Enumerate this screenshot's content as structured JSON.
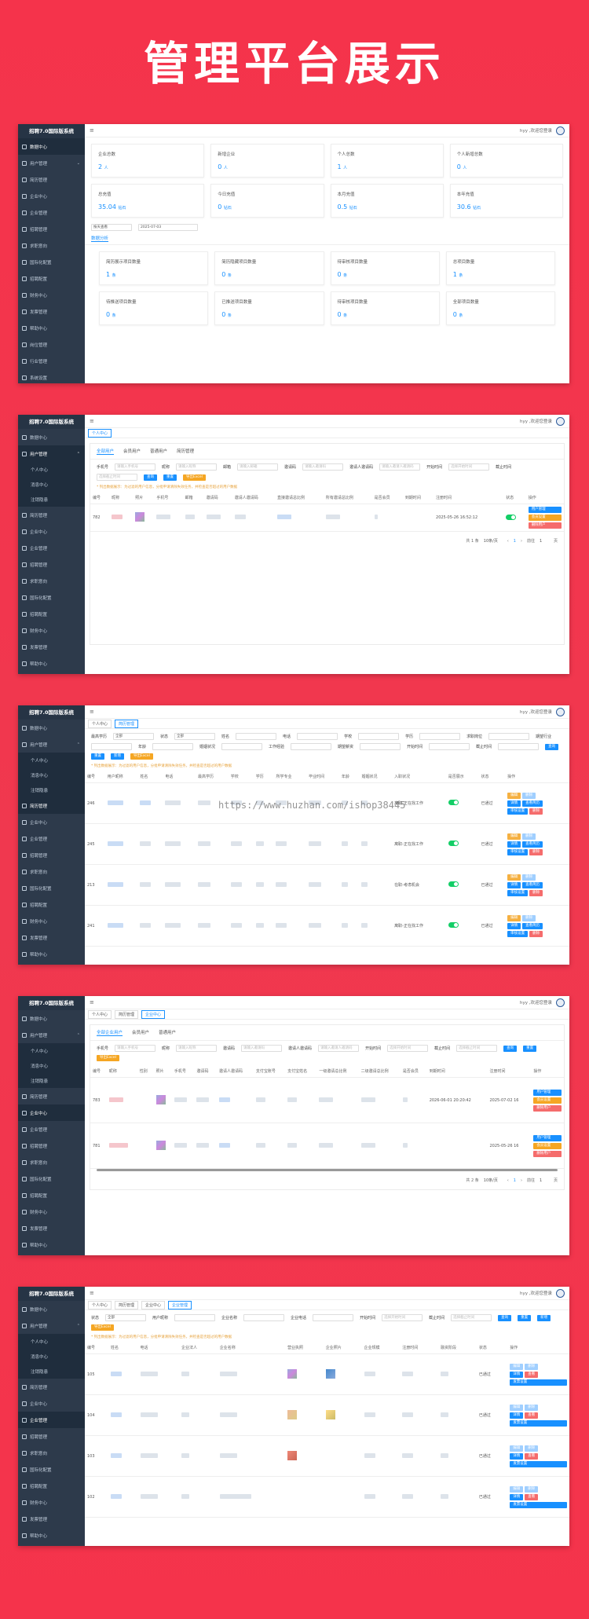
{
  "headline": "管理平台展示",
  "common": {
    "app_title": "招聘7.0国际版系统",
    "user": "hyy ,欢迎您登录",
    "menu": [
      "数据中心",
      "用户管理",
      "简历管理",
      "企业中心",
      "企业管理",
      "招聘管理",
      "求职意向",
      "国际化配置",
      "招聘配置",
      "财务中心",
      "发票管理",
      "帮助中心",
      "岗位管理",
      "行业管理",
      "系统设置"
    ],
    "submenu": [
      "个人中心",
      "消息中心",
      "注销隐患"
    ],
    "query": "查询",
    "reset": "重置",
    "export": "导出Excel",
    "add": "新增"
  },
  "shot1": {
    "cards_row1": [
      {
        "label": "企业总数",
        "value": "2",
        "unit": "人"
      },
      {
        "label": "新增企业",
        "value": "0",
        "unit": "人"
      },
      {
        "label": "个人总数",
        "value": "1",
        "unit": "人"
      },
      {
        "label": "个人新增总数",
        "value": "0",
        "unit": "人"
      }
    ],
    "cards_row2": [
      {
        "label": "总充值",
        "value": "35.04",
        "unit": "钻石"
      },
      {
        "label": "今日充值",
        "value": "0",
        "unit": "钻石"
      },
      {
        "label": "本月充值",
        "value": "0.5",
        "unit": "钻石"
      },
      {
        "label": "本年充值",
        "value": "30.6",
        "unit": "钻石"
      }
    ],
    "filter_select": "按天查看",
    "filter_date": "2025-07-03",
    "data_tab": "数据分析",
    "cards_row3": [
      {
        "label": "简历展示项目数量",
        "value": "1",
        "unit": "条"
      },
      {
        "label": "简历隐藏项目数量",
        "value": "0",
        "unit": "条"
      },
      {
        "label": "待审核项目数量",
        "value": "0",
        "unit": "条"
      },
      {
        "label": "总项目数量",
        "value": "1",
        "unit": "条"
      }
    ],
    "cards_row4": [
      {
        "label": "待推送项目数量",
        "value": "0",
        "unit": "条"
      },
      {
        "label": "已推送项目数量",
        "value": "0",
        "unit": "条"
      },
      {
        "label": "待审核项目数量",
        "value": "0",
        "unit": "条"
      },
      {
        "label": "全部项目数量",
        "value": "0",
        "unit": "条"
      }
    ]
  },
  "shot2": {
    "tags": [
      "个人中心"
    ],
    "tabs": [
      "全部用户",
      "会员用户",
      "普通用户",
      "简历管理"
    ],
    "filters": [
      "手机号",
      "昵称",
      "邮箱",
      "邀请码",
      "邀请人邀请码",
      "开始时间",
      "截止时间"
    ],
    "placeholders": [
      "请输入手机号",
      "请输入昵称",
      "请输入邮箱",
      "请输入邀请码",
      "请输入邀请人邀请码",
      "选择开始时间",
      "选择截止时间"
    ],
    "warning": "* 列出数据展示：为过滤的用户信息，分批申请清除失效任务，并检查是否超过的用户数据",
    "columns": [
      "编号",
      "昵称",
      "照片",
      "手机号",
      "邮箱",
      "邀请码",
      "邀请人邀请码",
      "直接邀请总比例",
      "所有邀请总比例",
      "是否会员",
      "到期时间",
      "注册时间",
      "状态",
      "操作"
    ],
    "row_id": "782",
    "row_time": "2025-05-26 16:52:12",
    "ops": [
      "用户管理",
      "会员设置",
      "删除用户"
    ],
    "pagination": {
      "total": "共 1 条",
      "size": "10条/页",
      "page": "1",
      "goto": "前往",
      "pages": "页"
    }
  },
  "shot3": {
    "tags": [
      "个人中心",
      "简历管理"
    ],
    "filters": [
      "最高学历",
      "状态",
      "姓名",
      "电话",
      "学校",
      "学历",
      "求职岗位",
      "期望行业",
      "年龄",
      "婚姻状况",
      "工作经验",
      "期望薪资",
      "开始时间",
      "截止时间"
    ],
    "filter_values": [
      "全部",
      "全部"
    ],
    "columns": [
      "编号",
      "用户昵称",
      "姓名",
      "电话",
      "最高学历",
      "学校",
      "学历",
      "所学专业",
      "毕业时间",
      "年龄",
      "婚姻状况",
      "入职状况",
      "是否展示",
      "状态",
      "操作"
    ],
    "rows": [
      {
        "id": "246",
        "job": "离职-正在找工作",
        "status": "已通过"
      },
      {
        "id": "245",
        "job": "离职-正在找工作",
        "status": "已通过"
      },
      {
        "id": "213",
        "job": "在职-考虑机会",
        "status": "已通过"
      },
      {
        "id": "241",
        "job": "离职-正在找工作",
        "status": "已通过"
      }
    ],
    "ops": [
      "编辑",
      "删除",
      "详情",
      "查看简历",
      "审核设置",
      "删除"
    ],
    "watermark": "https://www.huzhan.com/ishop38445"
  },
  "shot4": {
    "tags": [
      "个人中心",
      "简历管理",
      "企业中心"
    ],
    "tabs": [
      "全部企业用户",
      "会员用户",
      "普通用户"
    ],
    "filters": [
      "手机号",
      "昵称",
      "邀请码",
      "邀请人邀请码",
      "开始时间",
      "截止时间"
    ],
    "columns": [
      "编号",
      "昵称",
      "性别",
      "照片",
      "手机号",
      "邀请码",
      "邀请人邀请码",
      "支付宝账号",
      "支付宝姓名",
      "一级邀请总比例",
      "二级邀请总比例",
      "是否会员",
      "到期时间",
      "注册时间",
      "操作"
    ],
    "rows": [
      {
        "id": "783",
        "date1": "2026-06-01 20:20:42",
        "date2": "2025-07-02 16"
      },
      {
        "id": "781",
        "date1": "",
        "date2": "2025-05-26 16"
      }
    ],
    "ops": [
      "用户管理",
      "会员设置",
      "删除用户"
    ],
    "pagination": {
      "total": "共 2 条",
      "size": "10条/页",
      "page": "1",
      "goto": "前往",
      "pages": "页"
    }
  },
  "shot5": {
    "tags": [
      "个人中心",
      "简历管理",
      "企业中心",
      "企业管理"
    ],
    "filters": [
      "状态",
      "用户昵称",
      "企业名称",
      "企业电话",
      "开始时间",
      "截止时间"
    ],
    "filter_values": [
      "全部"
    ],
    "columns": [
      "编号",
      "姓名",
      "电话",
      "企业法人",
      "企业名称",
      "营业执照",
      "企业照片",
      "企业规模",
      "注册时间",
      "融资阶段",
      "状态",
      "操作"
    ],
    "rows": [
      {
        "id": "105",
        "status": "已通过"
      },
      {
        "id": "104",
        "status": "已通过"
      },
      {
        "id": "103",
        "status": "已通过"
      },
      {
        "id": "102",
        "status": "已通过"
      }
    ],
    "ops": [
      "编辑",
      "删除",
      "详情",
      "查看",
      "发票设置"
    ]
  },
  "colors": {
    "primary": "#1890ff",
    "sidebar": "#2d3a4b",
    "accent": "#f5334b",
    "success": "#13ce66",
    "warning": "#f5a623",
    "danger": "#f56c6c"
  }
}
